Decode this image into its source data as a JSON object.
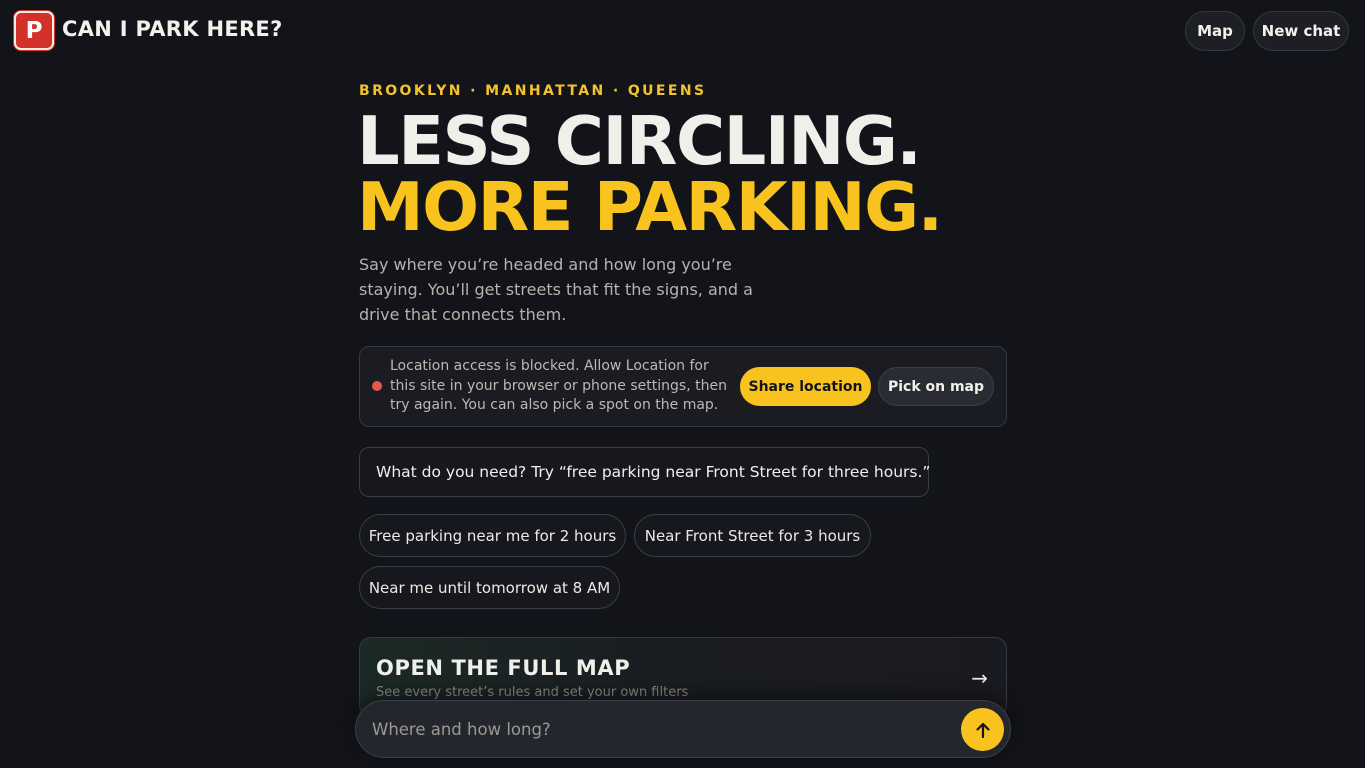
{
  "header": {
    "logo_letter": "P",
    "app_title": "CAN I PARK HERE?",
    "map_button": "Map",
    "new_chat_button": "New chat"
  },
  "hero": {
    "eyebrow": "BROOKLYN · MANHATTAN · QUEENS",
    "line1": "LESS CIRCLING.",
    "line2": "MORE PARKING.",
    "subtitle": "Say where you’re headed and how long you’re staying. You’ll get streets that fit the signs, and a drive that connects them."
  },
  "location_alert": {
    "message": "Location access is blocked. Allow Location for this site in your browser or phone settings, then try again. You can also pick a spot on the map.",
    "share_button": "Share location",
    "pick_button": "Pick on map",
    "status_color": "#e3584a"
  },
  "prompt": {
    "text": "What do you need? Try “free parking near Front Street for three hours.”"
  },
  "suggestions": [
    "Free parking near me for 2 hours",
    "Near Front Street for 3 hours",
    "Near me until tomorrow at 8 AM"
  ],
  "map_card": {
    "title": "OPEN THE FULL MAP",
    "subtitle": "See every street’s rules and set your own filters",
    "arrow": "→"
  },
  "composer": {
    "placeholder": "Where and how long?",
    "send_icon": "arrow-up-icon"
  },
  "colors": {
    "accent": "#f8c31f",
    "brand_red": "#d3322a",
    "background": "#131419"
  }
}
